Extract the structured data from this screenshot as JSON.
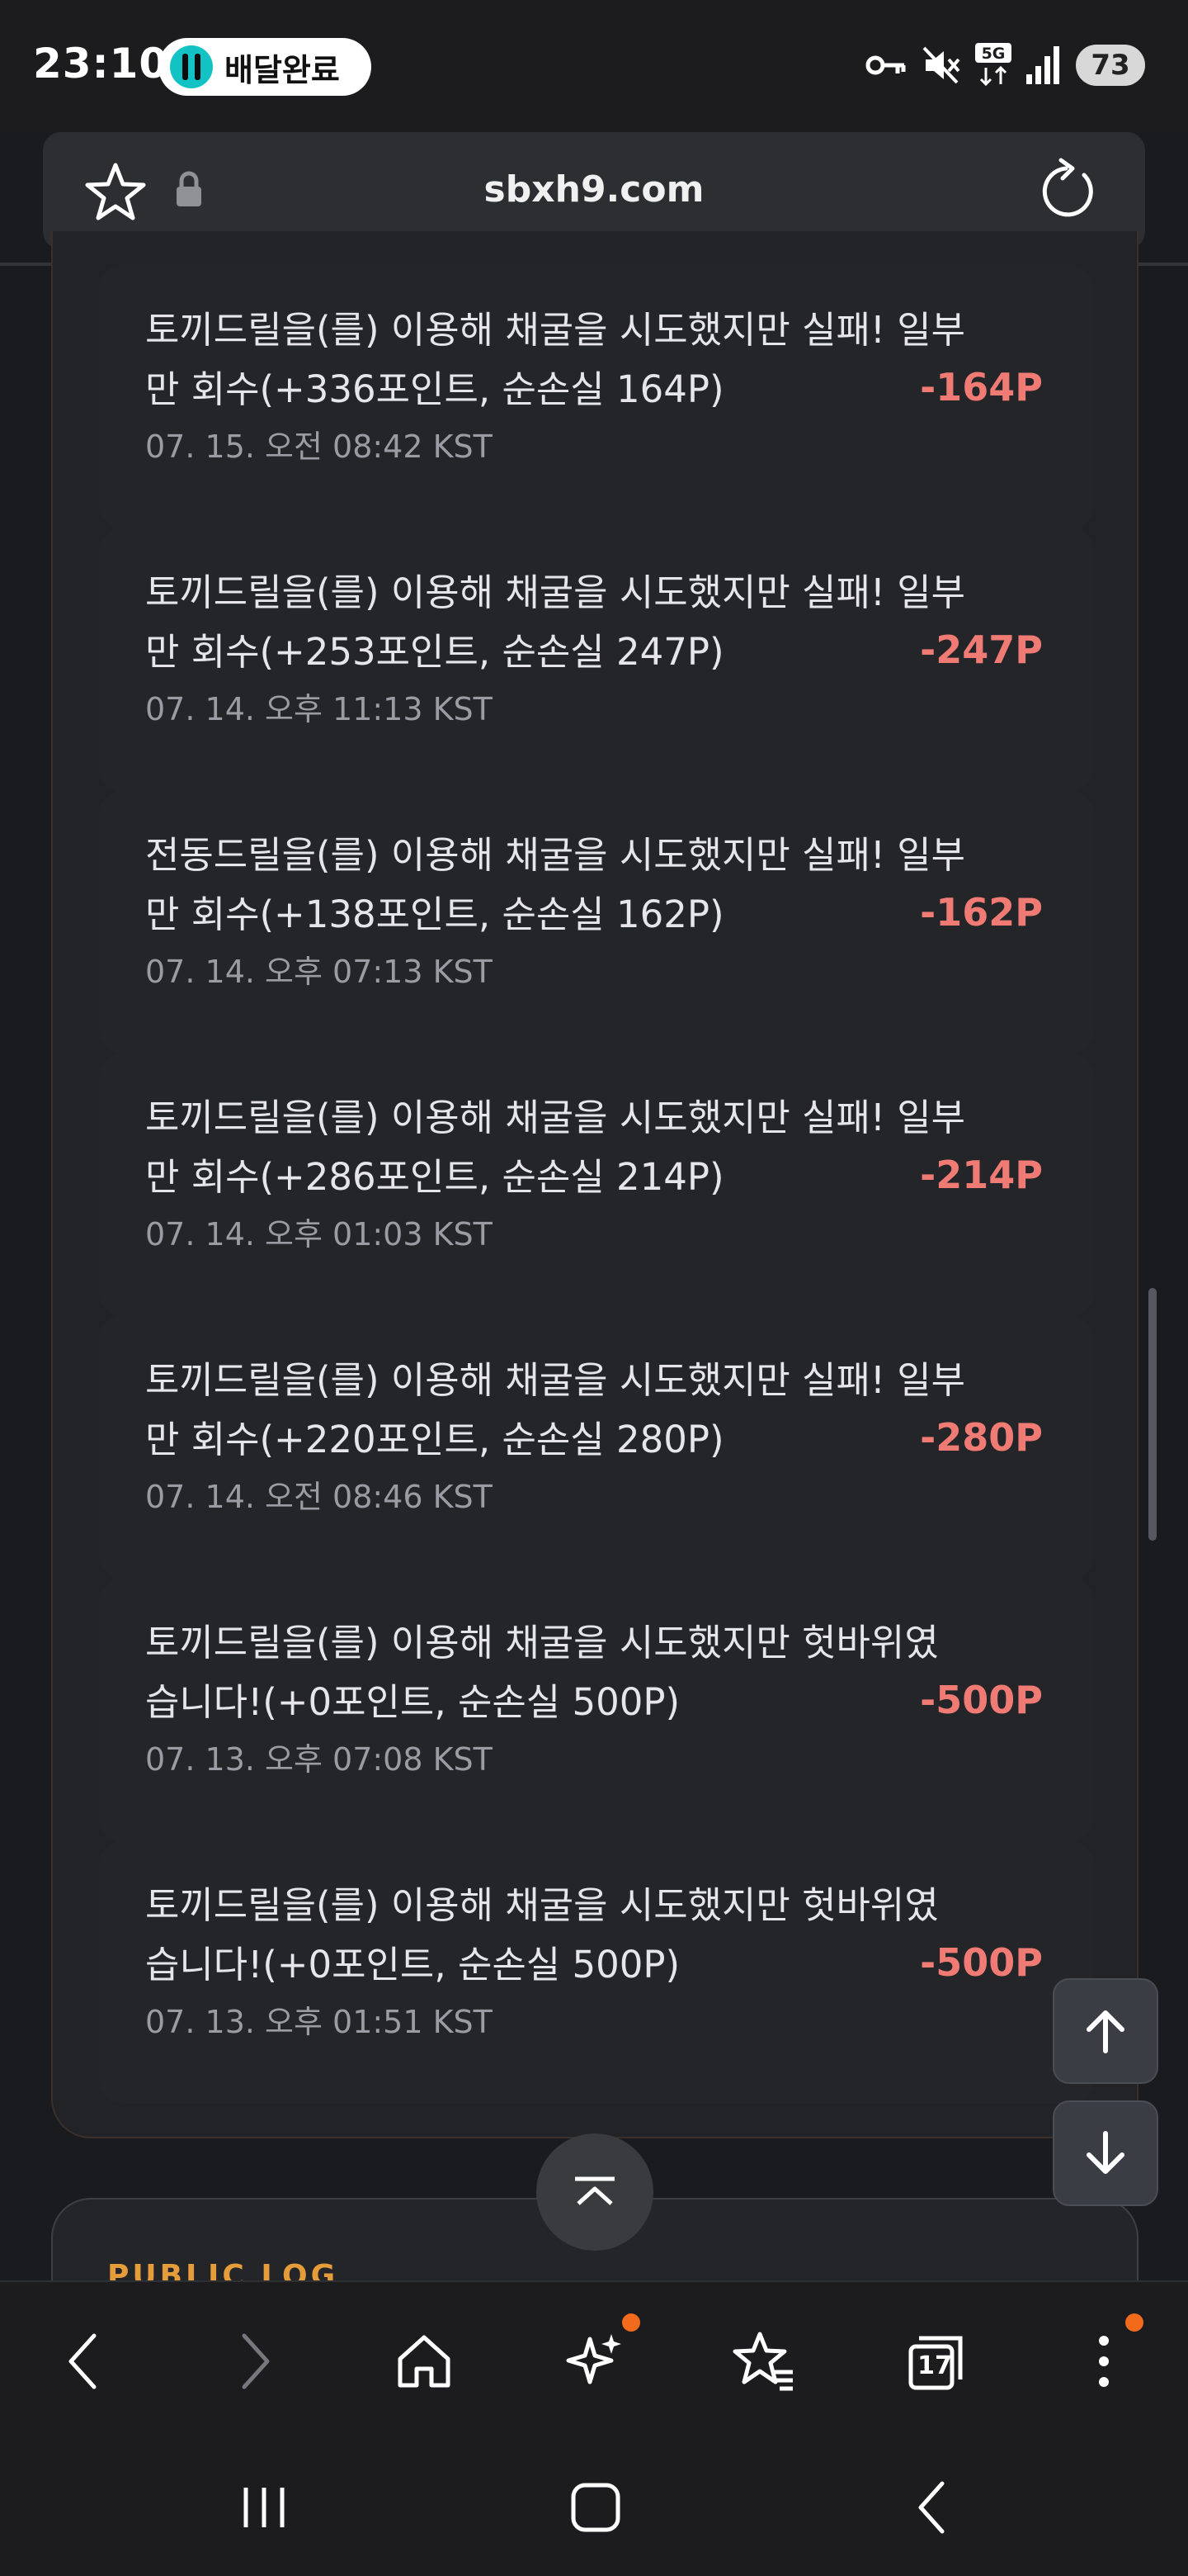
{
  "status_bar": {
    "time": "23:10",
    "notification": "배달완료",
    "battery": "73",
    "icons": [
      "key-icon",
      "mute-icon",
      "5g-icon",
      "signal-icon"
    ]
  },
  "browser": {
    "url": "sbxh9.com",
    "icons": [
      "star-icon",
      "lock-icon",
      "reload-icon"
    ]
  },
  "log_entries": [
    {
      "text": "토끼드릴을(를) 이용해 채굴을 시도했지만 실패! 일부만 회수(+336포인트, 순손실 164P)",
      "time": "07. 15. 오전 08:42 KST",
      "amount": "-164P"
    },
    {
      "text": "토끼드릴을(를) 이용해 채굴을 시도했지만 실패! 일부만 회수(+253포인트, 순손실 247P)",
      "time": "07. 14. 오후 11:13 KST",
      "amount": "-247P"
    },
    {
      "text": "전동드릴을(를) 이용해 채굴을 시도했지만 실패! 일부만 회수(+138포인트, 순손실 162P)",
      "time": "07. 14. 오후 07:13 KST",
      "amount": "-162P"
    },
    {
      "text": "토끼드릴을(를) 이용해 채굴을 시도했지만 실패! 일부만 회수(+286포인트, 순손실 214P)",
      "time": "07. 14. 오후 01:03 KST",
      "amount": "-214P"
    },
    {
      "text": "토끼드릴을(를) 이용해 채굴을 시도했지만 실패! 일부만 회수(+220포인트, 순손실 280P)",
      "time": "07. 14. 오전 08:46 KST",
      "amount": "-280P"
    },
    {
      "text": "토끼드릴을(를) 이용해 채굴을 시도했지만 헛바위였습니다!(+0포인트, 순손실 500P)",
      "time": "07. 13. 오후 07:08 KST",
      "amount": "-500P"
    },
    {
      "text": "토끼드릴을(를) 이용해 채굴을 시도했지만 헛바위였습니다!(+0포인트, 순손실 500P)",
      "time": "07. 13. 오후 01:51 KST",
      "amount": "-500P"
    }
  ],
  "public_log": {
    "title": "PUBLIC LOG"
  },
  "toolbar": {
    "tabs_count": "17",
    "items": [
      "back-icon",
      "forward-icon",
      "home-icon",
      "sparkle-icon",
      "bookmarks-icon",
      "tabs-icon",
      "more-icon"
    ]
  },
  "colors": {
    "background": "#1a1b1e",
    "card": "#222326",
    "negative_amount": "#f07b74",
    "accent_orange": "#e59c3a",
    "notification_dot": "#f26a1b"
  }
}
